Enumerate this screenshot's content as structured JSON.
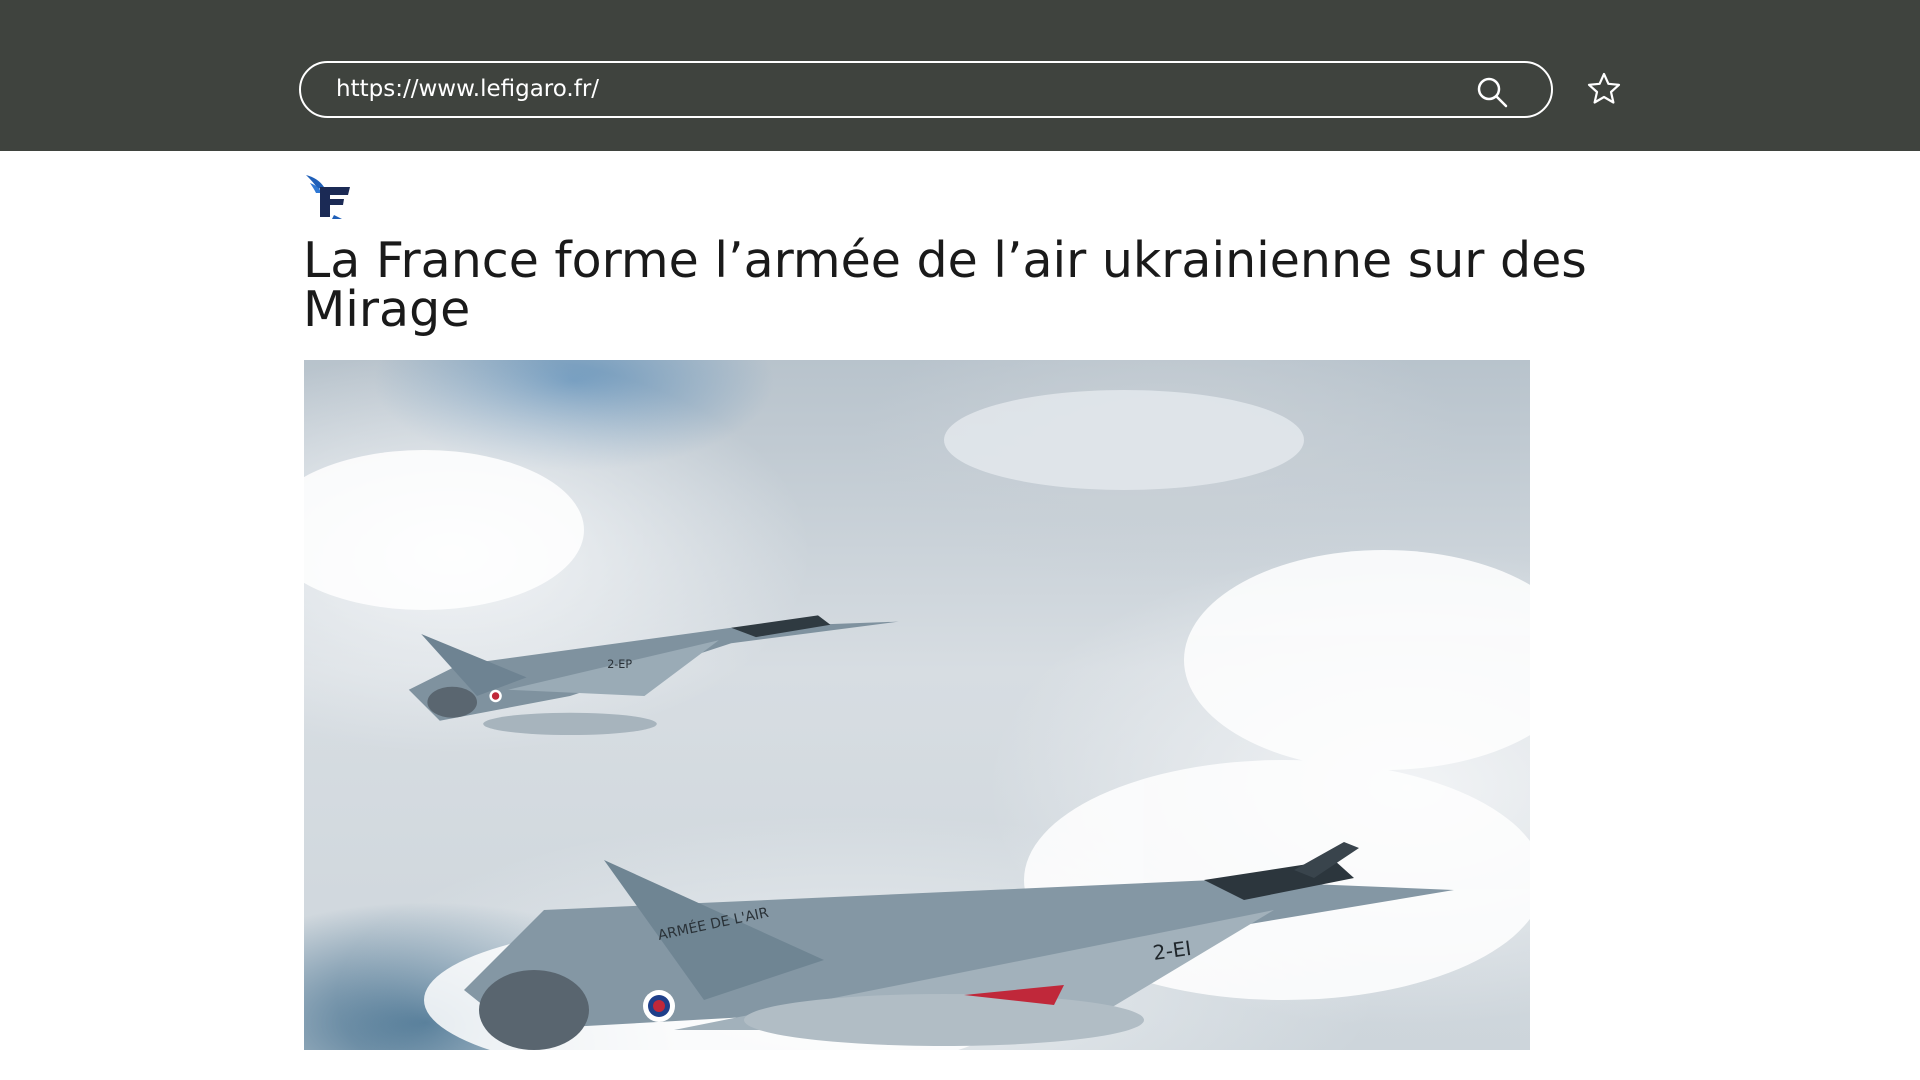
{
  "browser": {
    "url": "https://www.lefigaro.fr/",
    "search_icon": "search-icon",
    "bookmark_icon": "star-icon",
    "bar_color": "#3f433e"
  },
  "site": {
    "logo_icon": "le-figaro-logo",
    "logo_color": "#1f5fb8"
  },
  "article": {
    "headline": "La France forme l’armée de l’air ukrainienne sur des Mirage",
    "hero_image": "mirage-jets-over-clouds",
    "jet_markings": [
      "ARMÉE DE L'AIR",
      "2-EI",
      "2-EP"
    ]
  }
}
